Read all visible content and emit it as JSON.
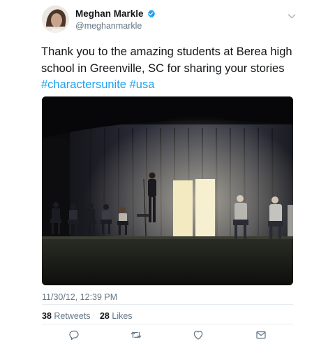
{
  "author": {
    "name": "Meghan Markle",
    "handle": "@meghanmarkle",
    "verified_icon": "verified-badge-icon",
    "avatar_icon": "profile-photo"
  },
  "tweet": {
    "text": "Thank you to the amazing students at Berea high school in Greenville, SC for sharing your stories",
    "hashtags": [
      "#charactersunite",
      "#usa"
    ],
    "timestamp": "11/30/12, 12:39 PM"
  },
  "media": {
    "description": "stage-photo"
  },
  "stats": {
    "retweets_count": "38",
    "retweets_label": "Retweets",
    "likes_count": "28",
    "likes_label": "Likes"
  },
  "actions": [
    "reply-icon",
    "retweet-icon",
    "like-icon",
    "direct-message-icon"
  ],
  "colors": {
    "accent": "#1da1f2",
    "text": "#14171a",
    "secondary_text": "#657786",
    "divider": "#e6ecf0"
  }
}
